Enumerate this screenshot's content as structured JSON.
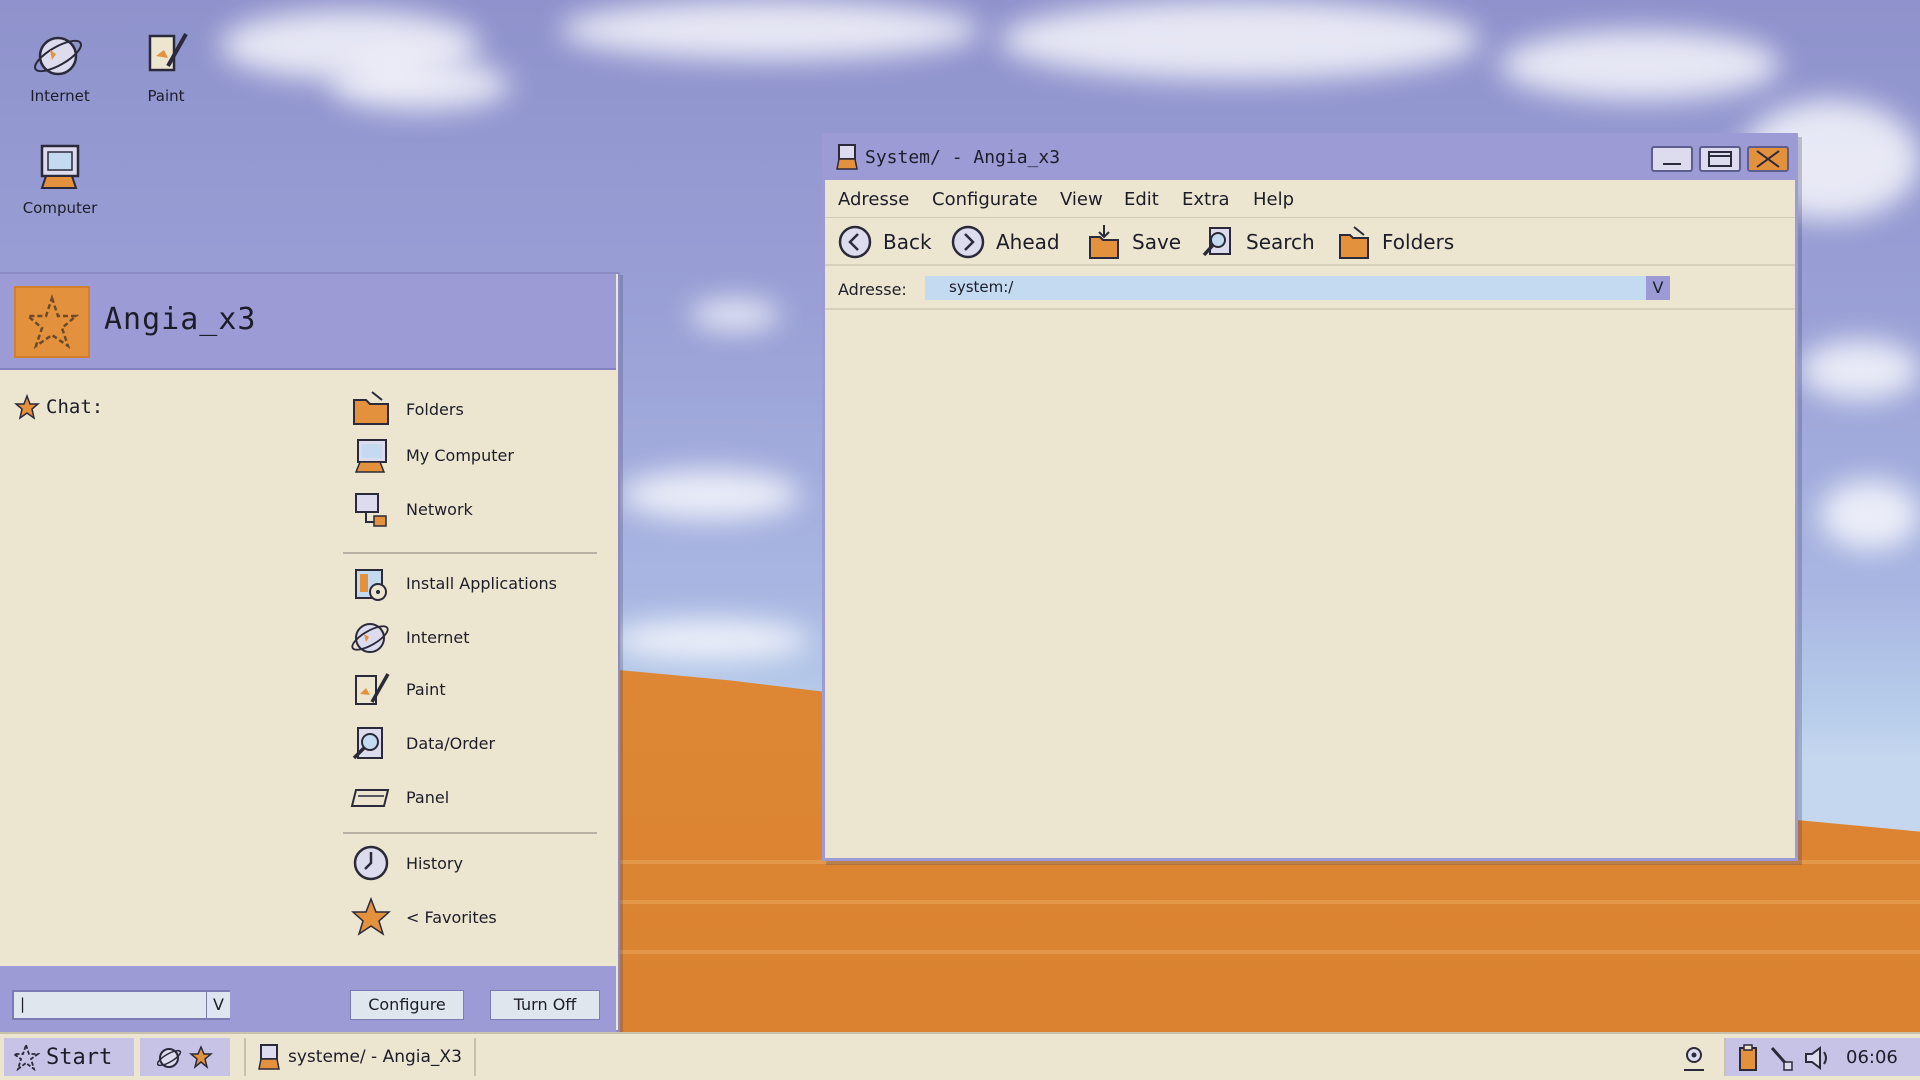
{
  "desktop": {
    "icons": [
      {
        "label": "Internet",
        "icon": "globe-icon"
      },
      {
        "label": "Paint",
        "icon": "paint-icon"
      },
      {
        "label": "Computer",
        "icon": "computer-icon"
      }
    ]
  },
  "start_menu": {
    "username": "Angia_x3",
    "avatar_icon": "star-avatar-icon",
    "chat_label": "Chat:",
    "items": [
      {
        "label": "Folders",
        "icon": "folder-icon"
      },
      {
        "label": "My Computer",
        "icon": "computer-icon"
      },
      {
        "label": "Network",
        "icon": "network-icon"
      },
      {
        "label": "Install Applications",
        "icon": "install-icon"
      },
      {
        "label": "Internet",
        "icon": "globe-icon"
      },
      {
        "label": "Paint",
        "icon": "paint-icon"
      },
      {
        "label": "Data/Order",
        "icon": "search-file-icon"
      },
      {
        "label": "Panel",
        "icon": "panel-icon"
      },
      {
        "label": "History",
        "icon": "clock-icon"
      },
      {
        "label": "< Favorites",
        "icon": "star-icon"
      }
    ],
    "footer": {
      "input_value": "|",
      "dropdown_arrow": "V",
      "configure_label": "Configure",
      "turnoff_label": "Turn Off"
    }
  },
  "window": {
    "title": "System/ - Angia_x3",
    "menu": [
      "Adresse",
      "Configurate",
      "View",
      "Edit",
      "Extra",
      "Help"
    ],
    "toolbar": [
      {
        "label": "Back",
        "icon": "back-arrow-icon"
      },
      {
        "label": "Ahead",
        "icon": "forward-arrow-icon"
      },
      {
        "label": "Save",
        "icon": "save-folder-icon"
      },
      {
        "label": "Search",
        "icon": "search-icon"
      },
      {
        "label": "Folders",
        "icon": "folder-icon"
      }
    ],
    "address_label": "Adresse:",
    "address_value": "system:/",
    "address_arrow": "V"
  },
  "taskbar": {
    "start_label": "Start",
    "task_label": "systeme/ - Angia_X3",
    "clock": "06:06"
  },
  "colors": {
    "accent": "#9d9bd6",
    "panel": "#ece6d0",
    "orange": "#e4913e",
    "field": "#c4daf0"
  }
}
